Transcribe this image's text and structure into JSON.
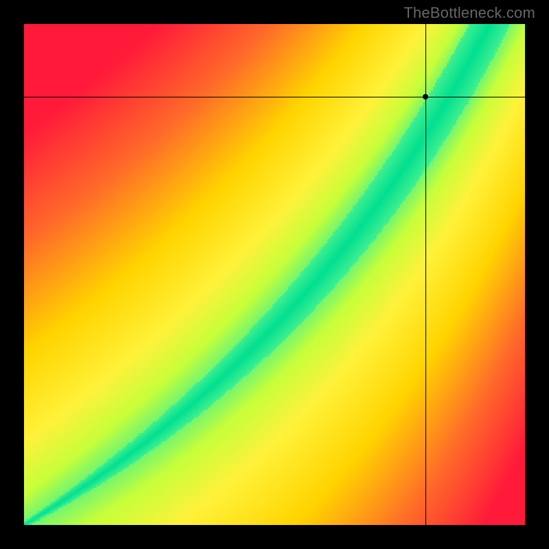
{
  "watermark": {
    "text": "TheBottleneck.com"
  },
  "layout": {
    "canvas_size": 800,
    "plot_offset": 35,
    "plot_size": 730,
    "heatmap_resolution": 256
  },
  "colors": {
    "background": "#000000",
    "watermark": "#666666",
    "crosshair": "#000000",
    "marker": "#000000",
    "stops": [
      {
        "t": 0.0,
        "hex": "#ff1a3a"
      },
      {
        "t": 0.25,
        "hex": "#ff6a2a"
      },
      {
        "t": 0.5,
        "hex": "#ffd400"
      },
      {
        "t": 0.7,
        "hex": "#fff23a"
      },
      {
        "t": 0.82,
        "hex": "#c6ff3a"
      },
      {
        "t": 0.92,
        "hex": "#40f090"
      },
      {
        "t": 1.0,
        "hex": "#00e090"
      }
    ]
  },
  "chart_data": {
    "type": "heatmap",
    "title": "",
    "xlabel": "",
    "ylabel": "",
    "xlim": [
      0,
      1
    ],
    "ylim": [
      0,
      1
    ],
    "note": "Cell score ≈ 1 − min(1, |y − ridge(x)| / halfwidth(x)); see ridge/halfwidth params. Axes are unlabeled normalized 0–1.",
    "ridge_params": {
      "description": "ridge(x) defines the crest (score=1) as a function of x in [0,1], y=0 at bottom",
      "p0": {
        "x": 0.0,
        "y": 0.0
      },
      "p1": {
        "x": 0.5,
        "y": 0.3
      },
      "p2": {
        "x": 0.78,
        "y": 0.7
      },
      "p3": {
        "x": 0.95,
        "y": 1.04
      }
    },
    "halfwidth_params": {
      "description": "green band half-thickness grows with x",
      "w0": 0.006,
      "w1": 0.085
    },
    "marker": {
      "x": 0.802,
      "y": 0.855
    },
    "crosshair": {
      "x": 0.802,
      "y": 0.855
    }
  }
}
